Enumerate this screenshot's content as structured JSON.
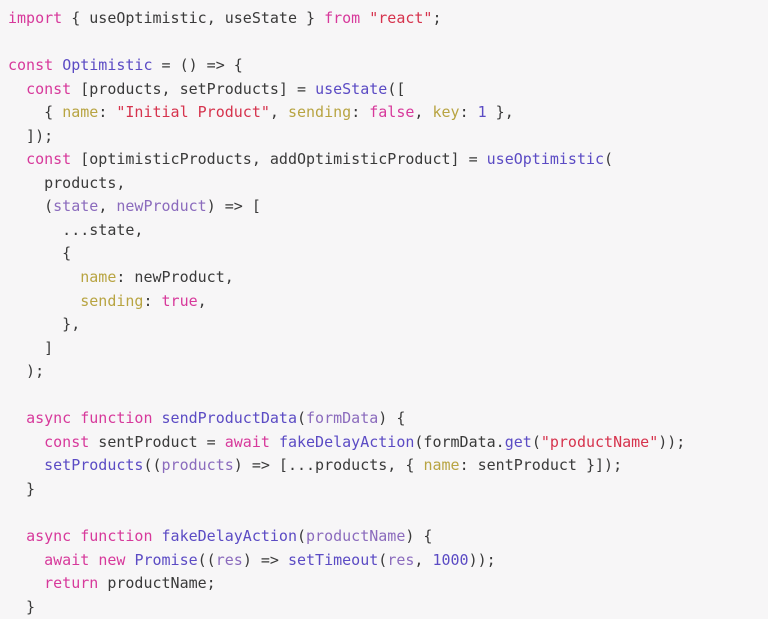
{
  "editor": {
    "language": "jsx",
    "background_color": "#f7f6f7",
    "font_size_px": 15,
    "line_height_px": 23.55,
    "theme_colors": {
      "keyword": "#d7399b",
      "function": "#5b4bc4",
      "string": "#d6334d",
      "object_key": "#b8a442",
      "parameter": "#8b6bbd",
      "number": "#5b4bc4",
      "plain": "#3a3a3a"
    }
  },
  "code": {
    "lines": [
      {
        "n": 1,
        "text": "import { useOptimistic, useState } from \"react\";",
        "tokens": [
          {
            "t": "import",
            "c": "keyword"
          },
          {
            "t": " { ",
            "c": "plain"
          },
          {
            "t": "useOptimistic",
            "c": "plain"
          },
          {
            "t": ", ",
            "c": "plain"
          },
          {
            "t": "useState",
            "c": "plain"
          },
          {
            "t": " } ",
            "c": "plain"
          },
          {
            "t": "from",
            "c": "keyword"
          },
          {
            "t": " ",
            "c": "plain"
          },
          {
            "t": "\"react\"",
            "c": "string"
          },
          {
            "t": ";",
            "c": "plain"
          }
        ]
      },
      {
        "n": 2,
        "text": "",
        "tokens": []
      },
      {
        "n": 3,
        "text": "const Optimistic = () => {",
        "tokens": [
          {
            "t": "const",
            "c": "keyword"
          },
          {
            "t": " ",
            "c": "plain"
          },
          {
            "t": "Optimistic",
            "c": "class"
          },
          {
            "t": " = () => {",
            "c": "plain"
          }
        ]
      },
      {
        "n": 4,
        "text": "  const [products, setProducts] = useState([",
        "tokens": [
          {
            "t": "  ",
            "c": "plain"
          },
          {
            "t": "const",
            "c": "keyword"
          },
          {
            "t": " [products, setProducts] = ",
            "c": "plain"
          },
          {
            "t": "useState",
            "c": "function"
          },
          {
            "t": "([",
            "c": "plain"
          }
        ]
      },
      {
        "n": 5,
        "text": "    { name: \"Initial Product\", sending: false, key: 1 },",
        "tokens": [
          {
            "t": "    { ",
            "c": "plain"
          },
          {
            "t": "name",
            "c": "key"
          },
          {
            "t": ": ",
            "c": "plain"
          },
          {
            "t": "\"Initial Product\"",
            "c": "string"
          },
          {
            "t": ", ",
            "c": "plain"
          },
          {
            "t": "sending",
            "c": "key"
          },
          {
            "t": ": ",
            "c": "plain"
          },
          {
            "t": "false",
            "c": "keyword"
          },
          {
            "t": ", ",
            "c": "plain"
          },
          {
            "t": "key",
            "c": "key"
          },
          {
            "t": ": ",
            "c": "plain"
          },
          {
            "t": "1",
            "c": "number"
          },
          {
            "t": " },",
            "c": "plain"
          }
        ]
      },
      {
        "n": 6,
        "text": "  ]);",
        "tokens": [
          {
            "t": "  ]);",
            "c": "plain"
          }
        ]
      },
      {
        "n": 7,
        "text": "  const [optimisticProducts, addOptimisticProduct] = useOptimistic(",
        "tokens": [
          {
            "t": "  ",
            "c": "plain"
          },
          {
            "t": "const",
            "c": "keyword"
          },
          {
            "t": " [optimisticProducts, addOptimisticProduct] = ",
            "c": "plain"
          },
          {
            "t": "useOptimistic",
            "c": "function"
          },
          {
            "t": "(",
            "c": "plain"
          }
        ]
      },
      {
        "n": 8,
        "text": "    products,",
        "tokens": [
          {
            "t": "    products,",
            "c": "plain"
          }
        ]
      },
      {
        "n": 9,
        "text": "    (state, newProduct) => [",
        "tokens": [
          {
            "t": "    (",
            "c": "plain"
          },
          {
            "t": "state",
            "c": "param"
          },
          {
            "t": ", ",
            "c": "plain"
          },
          {
            "t": "newProduct",
            "c": "param"
          },
          {
            "t": ") => [",
            "c": "plain"
          }
        ]
      },
      {
        "n": 10,
        "text": "      ...state,",
        "tokens": [
          {
            "t": "      ...state,",
            "c": "plain"
          }
        ]
      },
      {
        "n": 11,
        "text": "      {",
        "tokens": [
          {
            "t": "      {",
            "c": "plain"
          }
        ]
      },
      {
        "n": 12,
        "text": "        name: newProduct,",
        "tokens": [
          {
            "t": "        ",
            "c": "plain"
          },
          {
            "t": "name",
            "c": "key"
          },
          {
            "t": ": newProduct,",
            "c": "plain"
          }
        ]
      },
      {
        "n": 13,
        "text": "        sending: true,",
        "tokens": [
          {
            "t": "        ",
            "c": "plain"
          },
          {
            "t": "sending",
            "c": "key"
          },
          {
            "t": ": ",
            "c": "plain"
          },
          {
            "t": "true",
            "c": "keyword"
          },
          {
            "t": ",",
            "c": "plain"
          }
        ]
      },
      {
        "n": 14,
        "text": "      },",
        "tokens": [
          {
            "t": "      },",
            "c": "plain"
          }
        ]
      },
      {
        "n": 15,
        "text": "    ]",
        "tokens": [
          {
            "t": "    ]",
            "c": "plain"
          }
        ]
      },
      {
        "n": 16,
        "text": "  );",
        "tokens": [
          {
            "t": "  );",
            "c": "plain"
          }
        ]
      },
      {
        "n": 17,
        "text": "",
        "tokens": []
      },
      {
        "n": 18,
        "text": "  async function sendProductData(formData) {",
        "tokens": [
          {
            "t": "  ",
            "c": "plain"
          },
          {
            "t": "async function",
            "c": "keyword"
          },
          {
            "t": " ",
            "c": "plain"
          },
          {
            "t": "sendProductData",
            "c": "function"
          },
          {
            "t": "(",
            "c": "plain"
          },
          {
            "t": "formData",
            "c": "param"
          },
          {
            "t": ") {",
            "c": "plain"
          }
        ]
      },
      {
        "n": 19,
        "text": "    const sentProduct = await fakeDelayAction(formData.get(\"productName\"));",
        "tokens": [
          {
            "t": "    ",
            "c": "plain"
          },
          {
            "t": "const",
            "c": "keyword"
          },
          {
            "t": " sentProduct = ",
            "c": "plain"
          },
          {
            "t": "await",
            "c": "keyword"
          },
          {
            "t": " ",
            "c": "plain"
          },
          {
            "t": "fakeDelayAction",
            "c": "function"
          },
          {
            "t": "(formData.",
            "c": "plain"
          },
          {
            "t": "get",
            "c": "function"
          },
          {
            "t": "(",
            "c": "plain"
          },
          {
            "t": "\"productName\"",
            "c": "string"
          },
          {
            "t": "));",
            "c": "plain"
          }
        ]
      },
      {
        "n": 20,
        "text": "    setProducts((products) => [...products, { name: sentProduct }]);",
        "tokens": [
          {
            "t": "    ",
            "c": "plain"
          },
          {
            "t": "setProducts",
            "c": "function"
          },
          {
            "t": "((",
            "c": "plain"
          },
          {
            "t": "products",
            "c": "param"
          },
          {
            "t": ") => [...products, { ",
            "c": "plain"
          },
          {
            "t": "name",
            "c": "key"
          },
          {
            "t": ": sentProduct }]);",
            "c": "plain"
          }
        ]
      },
      {
        "n": 21,
        "text": "  }",
        "tokens": [
          {
            "t": "  }",
            "c": "plain"
          }
        ]
      },
      {
        "n": 22,
        "text": "",
        "tokens": []
      },
      {
        "n": 23,
        "text": "  async function fakeDelayAction(productName) {",
        "tokens": [
          {
            "t": "  ",
            "c": "plain"
          },
          {
            "t": "async function",
            "c": "keyword"
          },
          {
            "t": " ",
            "c": "plain"
          },
          {
            "t": "fakeDelayAction",
            "c": "function"
          },
          {
            "t": "(",
            "c": "plain"
          },
          {
            "t": "productName",
            "c": "param"
          },
          {
            "t": ") {",
            "c": "plain"
          }
        ]
      },
      {
        "n": 24,
        "text": "    await new Promise((res) => setTimeout(res, 1000));",
        "tokens": [
          {
            "t": "    ",
            "c": "plain"
          },
          {
            "t": "await",
            "c": "keyword"
          },
          {
            "t": " ",
            "c": "plain"
          },
          {
            "t": "new",
            "c": "keyword"
          },
          {
            "t": " ",
            "c": "plain"
          },
          {
            "t": "Promise",
            "c": "function"
          },
          {
            "t": "((",
            "c": "plain"
          },
          {
            "t": "res",
            "c": "param"
          },
          {
            "t": ") => ",
            "c": "plain"
          },
          {
            "t": "setTimeout",
            "c": "function"
          },
          {
            "t": "(",
            "c": "plain"
          },
          {
            "t": "res",
            "c": "param"
          },
          {
            "t": ", ",
            "c": "plain"
          },
          {
            "t": "1000",
            "c": "number"
          },
          {
            "t": "));",
            "c": "plain"
          }
        ]
      },
      {
        "n": 25,
        "text": "    return productName;",
        "tokens": [
          {
            "t": "    ",
            "c": "plain"
          },
          {
            "t": "return",
            "c": "keyword"
          },
          {
            "t": " productName;",
            "c": "plain"
          }
        ]
      },
      {
        "n": 26,
        "text": "  }",
        "tokens": [
          {
            "t": "  }",
            "c": "plain"
          }
        ]
      }
    ]
  }
}
